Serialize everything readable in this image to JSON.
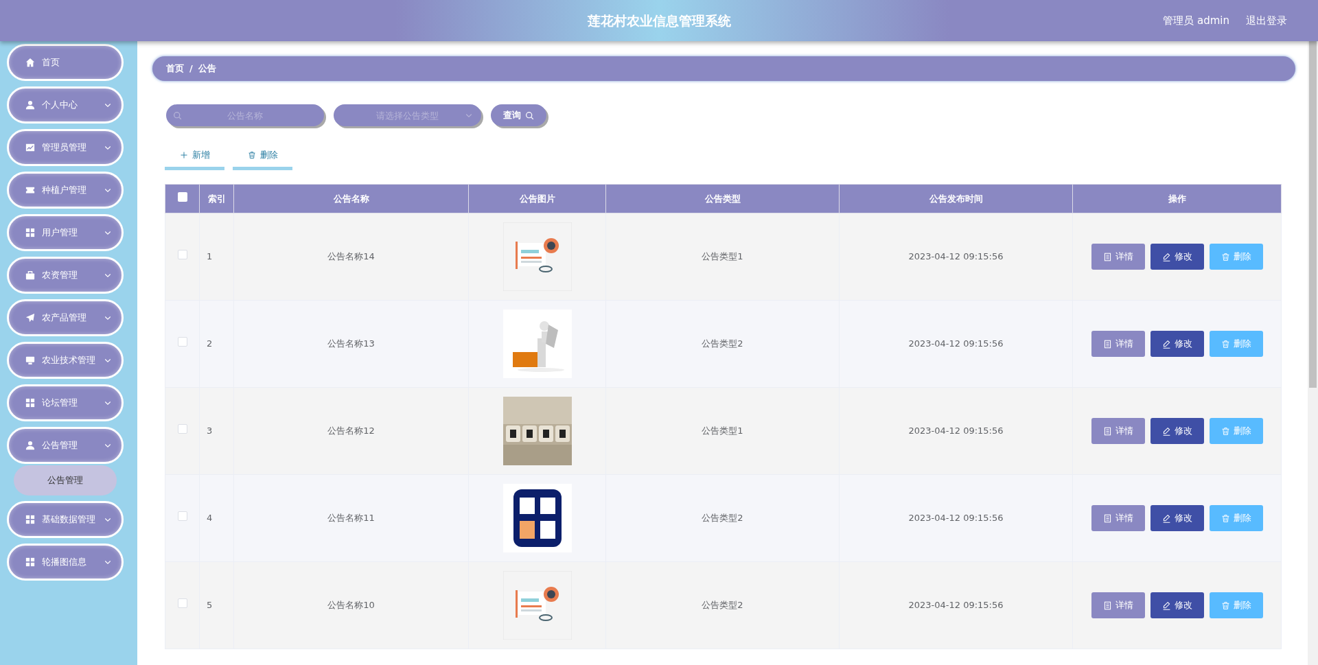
{
  "header": {
    "title": "莲花村农业信息管理系统",
    "user": "管理员 admin",
    "logout": "退出登录"
  },
  "sidebar": {
    "items": [
      {
        "label": "首页",
        "expandable": false
      },
      {
        "label": "个人中心",
        "expandable": true
      },
      {
        "label": "管理员管理",
        "expandable": true
      },
      {
        "label": "种植户管理",
        "expandable": true
      },
      {
        "label": "用户管理",
        "expandable": true
      },
      {
        "label": "农资管理",
        "expandable": true
      },
      {
        "label": "农产品管理",
        "expandable": true
      },
      {
        "label": "农业技术管理",
        "expandable": true
      },
      {
        "label": "论坛管理",
        "expandable": true
      },
      {
        "label": "公告管理",
        "expandable": true,
        "children": [
          {
            "label": "公告管理",
            "selected": true
          }
        ]
      },
      {
        "label": "基础数据管理",
        "expandable": true
      },
      {
        "label": "轮播图信息",
        "expandable": true
      }
    ]
  },
  "breadcrumb": {
    "items": [
      "首页",
      "公告"
    ],
    "separator": "/"
  },
  "search": {
    "name_placeholder": "公告名称",
    "type_placeholder": "请选择公告类型",
    "button": "查询"
  },
  "toolbar": [
    {
      "label": "新增",
      "kind": "add"
    },
    {
      "label": "删除",
      "kind": "delete"
    }
  ],
  "table": {
    "select_all_checked": false,
    "columns": [
      "索引",
      "公告名称",
      "公告图片",
      "公告类型",
      "公告发布时间",
      "操作"
    ],
    "rows": [
      {
        "checked": false,
        "index": "1",
        "name": "公告名称14",
        "type": "公告类型1",
        "time": "2023-04-12 09:15:56",
        "actions": [
          {
            "label": "详情",
            "kind": "detail"
          },
          {
            "label": "修改",
            "kind": "edit"
          },
          {
            "label": "删除",
            "kind": "delete"
          }
        ]
      },
      {
        "checked": false,
        "index": "2",
        "name": "公告名称13",
        "type": "公告类型2",
        "time": "2023-04-12 09:15:56",
        "actions": [
          {
            "label": "详情",
            "kind": "detail"
          },
          {
            "label": "修改",
            "kind": "edit"
          },
          {
            "label": "删除",
            "kind": "delete"
          }
        ]
      },
      {
        "checked": false,
        "index": "3",
        "name": "公告名称12",
        "type": "公告类型1",
        "time": "2023-04-12 09:15:56",
        "actions": [
          {
            "label": "详情",
            "kind": "detail"
          },
          {
            "label": "修改",
            "kind": "edit"
          },
          {
            "label": "删除",
            "kind": "delete"
          }
        ]
      },
      {
        "checked": false,
        "index": "4",
        "name": "公告名称11",
        "type": "公告类型2",
        "time": "2023-04-12 09:15:56",
        "actions": [
          {
            "label": "详情",
            "kind": "detail"
          },
          {
            "label": "修改",
            "kind": "edit"
          },
          {
            "label": "删除",
            "kind": "delete"
          }
        ]
      },
      {
        "checked": false,
        "index": "5",
        "name": "公告名称10",
        "type": "公告类型2",
        "time": "2023-04-12 09:15:56",
        "actions": [
          {
            "label": "详情",
            "kind": "detail"
          },
          {
            "label": "修改",
            "kind": "edit"
          },
          {
            "label": "删除",
            "kind": "delete"
          }
        ]
      }
    ]
  }
}
